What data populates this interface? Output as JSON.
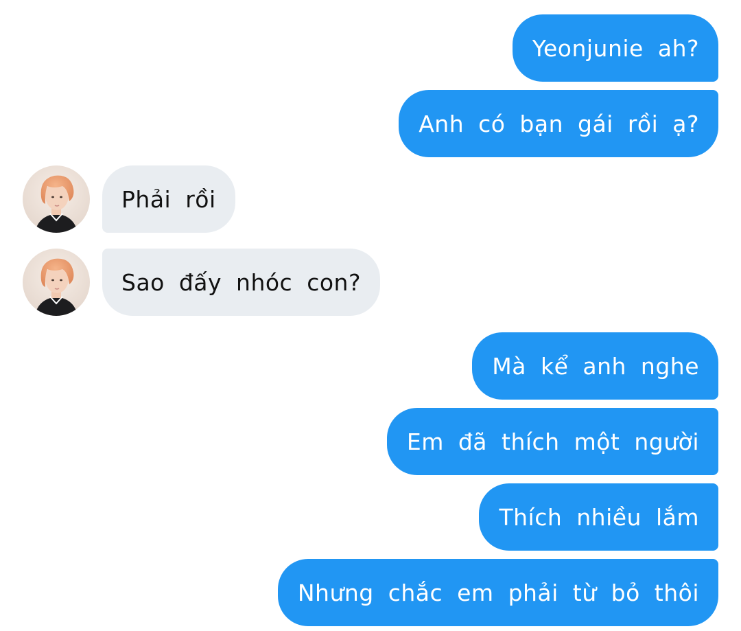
{
  "conversation": {
    "contact_avatar_icon": "profile-photo",
    "colors": {
      "sent_bubble": "#2196f3",
      "received_bubble": "#e9edf1"
    },
    "messages": [
      {
        "sender": "me",
        "text": "Yeonjunie ah?"
      },
      {
        "sender": "me",
        "text": "Anh có bạn gái rồi ạ?"
      },
      {
        "sender": "contact",
        "text": "Phải rồi"
      },
      {
        "sender": "contact",
        "text": "Sao đấy nhóc con?"
      },
      {
        "sender": "me",
        "text": "Mà kể anh nghe"
      },
      {
        "sender": "me",
        "text": "Em đã thích một người"
      },
      {
        "sender": "me",
        "text": "Thích nhiều lắm"
      },
      {
        "sender": "me",
        "text": "Nhưng chắc em phải từ bỏ thôi"
      }
    ]
  }
}
